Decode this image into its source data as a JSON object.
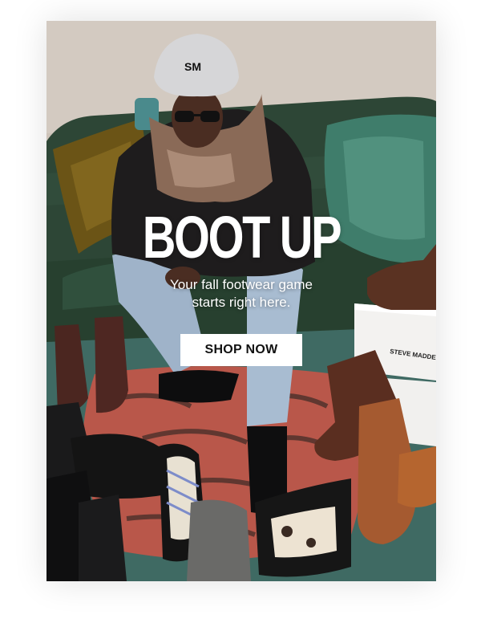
{
  "hero": {
    "headline": "BOOT UP",
    "subhead_line1": "Your fall footwear game",
    "subhead_line2": "starts right here.",
    "cta_label": "SHOP NOW",
    "box_brand": "STEVE MADDEN",
    "beanie_logo": "SM"
  },
  "colors": {
    "wall": "#c9c0b6",
    "sofa": "#2f4a3a",
    "rug": "#b9574a",
    "button_bg": "#ffffff",
    "button_text": "#111111",
    "headline_text": "#ffffff"
  }
}
